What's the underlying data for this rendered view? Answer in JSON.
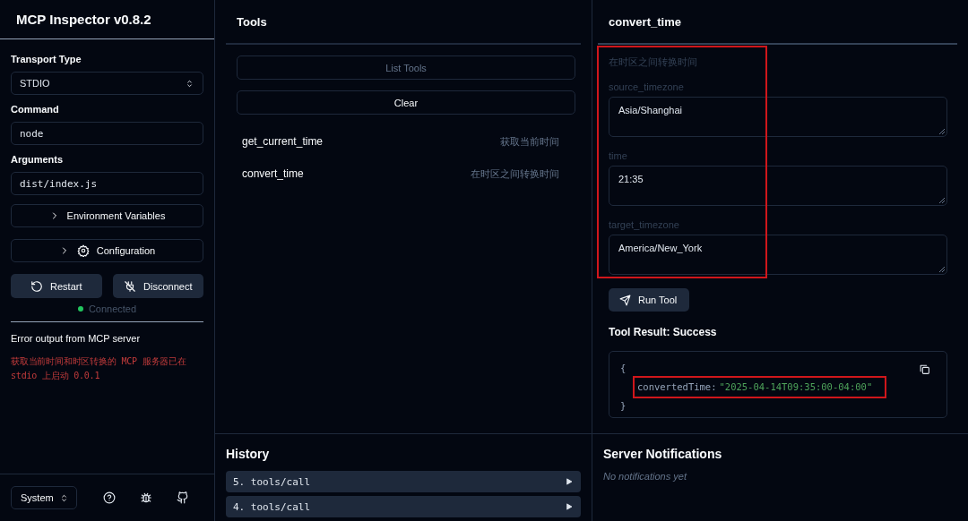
{
  "sidebar": {
    "title": "MCP Inspector v0.8.2",
    "transport": {
      "label": "Transport Type",
      "value": "STDIO"
    },
    "command": {
      "label": "Command",
      "value": "node"
    },
    "arguments": {
      "label": "Arguments",
      "value": "dist/index.js"
    },
    "sections": [
      {
        "label": "Environment Variables",
        "kind": "plain",
        "expanded": false
      },
      {
        "label": "Configuration",
        "kind": "gear",
        "expanded": false
      }
    ],
    "buttons": [
      {
        "label": "Restart",
        "kind": "restart"
      },
      {
        "label": "Disconnect",
        "kind": "disconnect"
      }
    ],
    "status": {
      "label": "Connected",
      "connected": true
    },
    "error_output": {
      "title": "Error output from MCP server",
      "text": "获取当前时间和时区转换的 MCP 服务器已在 stdio 上启动 0.0.1"
    },
    "theme": "System"
  },
  "tools": {
    "title": "Tools",
    "buttons": [
      {
        "label": "List Tools",
        "disabled": true
      },
      {
        "label": "Clear",
        "disabled": false
      }
    ],
    "items": [
      {
        "name": "get_current_time",
        "description": "获取当前时间"
      },
      {
        "name": "convert_time",
        "description": "在时区之间转换时间"
      }
    ]
  },
  "tool_detail": {
    "title": "convert_time",
    "description": "在时区之间转换时间",
    "fields": [
      {
        "label": "source_timezone",
        "value": "Asia/Shanghai"
      },
      {
        "label": "time",
        "value": "21:35"
      },
      {
        "label": "target_timezone",
        "value": "America/New_York"
      }
    ],
    "run_button": "Run Tool",
    "result": {
      "title": "Tool Result: Success",
      "open_brace": "{",
      "key": "convertedTime:",
      "value": "\"2025-04-14T09:35:00-04:00\"",
      "close_brace": "}"
    }
  },
  "history": {
    "title": "History",
    "items": [
      "5. tools/call",
      "4. tools/call"
    ]
  },
  "notifications": {
    "title": "Server Notifications",
    "empty_text": "No notifications yet"
  }
}
